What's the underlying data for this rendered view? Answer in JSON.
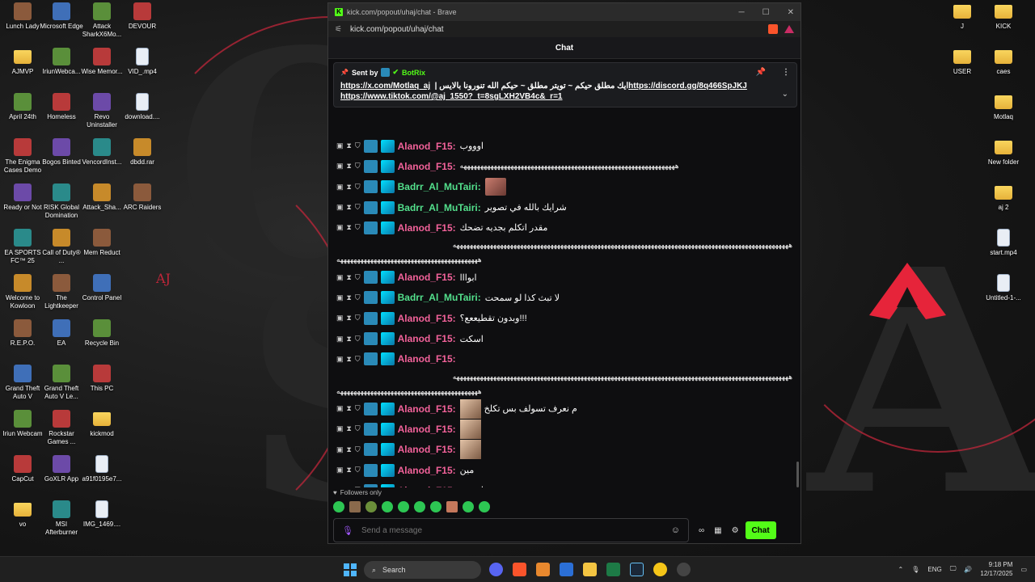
{
  "desktop": {
    "col1": [
      {
        "label": "Lunch Lady",
        "icon": "game-icon"
      },
      {
        "label": "AJMVP",
        "icon": "folder-icon"
      },
      {
        "label": "April 24th",
        "icon": "game-icon"
      },
      {
        "label": "The Enigma Cases Demo",
        "icon": "game-icon"
      },
      {
        "label": "Ready or Not",
        "icon": "game-icon"
      },
      {
        "label": "EA SPORTS FC™ 25",
        "icon": "game-icon"
      },
      {
        "label": "Welcome to Kowloon",
        "icon": "game-icon"
      },
      {
        "label": "R.E.P.O.",
        "icon": "game-icon"
      },
      {
        "label": "Grand Theft Auto V",
        "icon": "game-icon"
      },
      {
        "label": "Iriun Webcam",
        "icon": "webcam-icon"
      },
      {
        "label": "CapCut",
        "icon": "capcut-icon"
      },
      {
        "label": "vo",
        "icon": "folder-icon"
      }
    ],
    "col2": [
      {
        "label": "Microsoft Edge",
        "icon": "edge-icon"
      },
      {
        "label": "IriunWebca...",
        "icon": "webcam-icon"
      },
      {
        "label": "Homeless",
        "icon": "game-icon"
      },
      {
        "label": "Bogos Binted",
        "icon": "game-icon"
      },
      {
        "label": "RISK Global Domination",
        "icon": "game-icon"
      },
      {
        "label": "Call of Duty® ...",
        "icon": "game-icon"
      },
      {
        "label": "The Lightkeeper",
        "icon": "game-icon"
      },
      {
        "label": "EA",
        "icon": "ea-icon"
      },
      {
        "label": "Grand Theft Auto V Le...",
        "icon": "game-icon"
      },
      {
        "label": "Rockstar Games ...",
        "icon": "rockstar-icon"
      },
      {
        "label": "GoXLR App",
        "icon": "goxlr-icon"
      },
      {
        "label": "MSI Afterburner",
        "icon": "msi-icon"
      }
    ],
    "col3": [
      {
        "label": "Attack SharkX6Mo...",
        "icon": "shark-icon"
      },
      {
        "label": "Wise Memor...",
        "icon": "wise-icon"
      },
      {
        "label": "Revo Uninstaller",
        "icon": "revo-icon"
      },
      {
        "label": "VencordInst...",
        "icon": "vencord-icon"
      },
      {
        "label": "Attack_Sha...",
        "icon": "shark-icon"
      },
      {
        "label": "Mem Reduct",
        "icon": "memreduct-icon"
      },
      {
        "label": "Control Panel",
        "icon": "control-panel-icon"
      },
      {
        "label": "Recycle Bin",
        "icon": "recycle-bin-icon"
      },
      {
        "label": "This PC",
        "icon": "this-pc-icon"
      },
      {
        "label": "kickmod",
        "icon": "folder-icon"
      },
      {
        "label": "a91f0195e7...",
        "icon": "file-icon"
      },
      {
        "label": "IMG_1469....",
        "icon": "file-icon"
      }
    ],
    "col4": [
      {
        "label": "DEVOUR",
        "icon": "game-icon"
      },
      {
        "label": "VID_.mp4",
        "icon": "file-icon"
      },
      {
        "label": "download....",
        "icon": "file-icon"
      },
      {
        "label": "dbdd.rar",
        "icon": "rar-icon"
      },
      {
        "label": "ARC Raiders",
        "icon": "game-icon"
      }
    ],
    "right1": [
      {
        "label": "J",
        "icon": "folder-icon"
      },
      {
        "label": "USER",
        "icon": "folder-icon"
      }
    ],
    "right2": [
      {
        "label": "KICK",
        "icon": "folder-icon"
      },
      {
        "label": "caes",
        "icon": "folder-icon"
      },
      {
        "label": "Motlaq",
        "icon": "folder-icon"
      },
      {
        "label": "New folder",
        "icon": "folder-icon"
      },
      {
        "label": "aj 2",
        "icon": "folder-icon"
      },
      {
        "label": "start.mp4",
        "icon": "file-icon"
      },
      {
        "label": "Untitled-1-...",
        "icon": "file-icon"
      }
    ],
    "wallpaper_mark": "AJ"
  },
  "window": {
    "title": "kick.com/popout/uhaj/chat - Brave",
    "url": "kick.com/popout/uhaj/chat",
    "chat_title": "Chat"
  },
  "pinned": {
    "sent_by": "Sent by",
    "bot_name": "BotRix",
    "text": "ايك مطلق حيكم ~ تويتر مطلق ~ حيكم الله تنورونا بالايس | ",
    "link1": "https://x.com/Motlaq_aj",
    "link2": "https://discord.gg/8q466SpJKJ",
    "link3": "https://www.tiktok.com/@aj_1550?_t=8sgLXH2VB4c&_r=1"
  },
  "messages": [
    {
      "user": "Alanod_F15",
      "color": "#f2629a",
      "text": "اوووب"
    },
    {
      "user": "Alanod_F15",
      "color": "#f2629a",
      "text": "ههههههههههههههههههههههههههههههههههههههههههههههههههههههههههههههههه"
    },
    {
      "user": "Badrr_Al_MuTairi",
      "color": "#53e08c",
      "text": ""
    },
    {
      "user": "Badrr_Al_MuTairi",
      "color": "#53e08c",
      "text": "شرايك بالله في تصوير"
    },
    {
      "user": "Alanod_F15",
      "color": "#f2629a",
      "text": "مقدر اتكلم بجديه تضحك"
    },
    {
      "user": "Alanod_F15",
      "color": "#f2629a",
      "text": "ابوااا"
    },
    {
      "user": "Badrr_Al_MuTairi",
      "color": "#53e08c",
      "text": "لا تبث كذا لو سمحت"
    },
    {
      "user": "Alanod_F15",
      "color": "#f2629a",
      "text": "!!!وبدون تقطيععع؟"
    },
    {
      "user": "Alanod_F15",
      "color": "#f2629a",
      "text": "اسكت"
    },
    {
      "user": "Alanod_F15",
      "color": "#f2629a",
      "text": ""
    },
    {
      "user": "Alanod_F15",
      "color": "#f2629a",
      "text": "م نعرف تسولف بس تكلخ"
    },
    {
      "user": "Alanod_F15",
      "color": "#f2629a",
      "text": ""
    },
    {
      "user": "Alanod_F15",
      "color": "#f2629a",
      "text": ""
    },
    {
      "user": "Alanod_F15",
      "color": "#f2629a",
      "text": "مين"
    },
    {
      "user": "Alanod_F15",
      "color": "#f2629a",
      "text": "اوووب"
    }
  ],
  "long_line": "ههههههههههههههههههههههههههههههههههههههههههههههههههههههههههههههههههههههههههههههههههههههههههههههههههههه",
  "long_line_tail": "ههههههههههههههههههههههههههههههههههههههههههه",
  "footer": {
    "followers": "Followers only",
    "placeholder": "Send a message",
    "chat_button": "Chat"
  },
  "taskbar": {
    "search": "Search",
    "lang": "ENG",
    "time": "9:18 PM",
    "date": "12/17/2025"
  }
}
